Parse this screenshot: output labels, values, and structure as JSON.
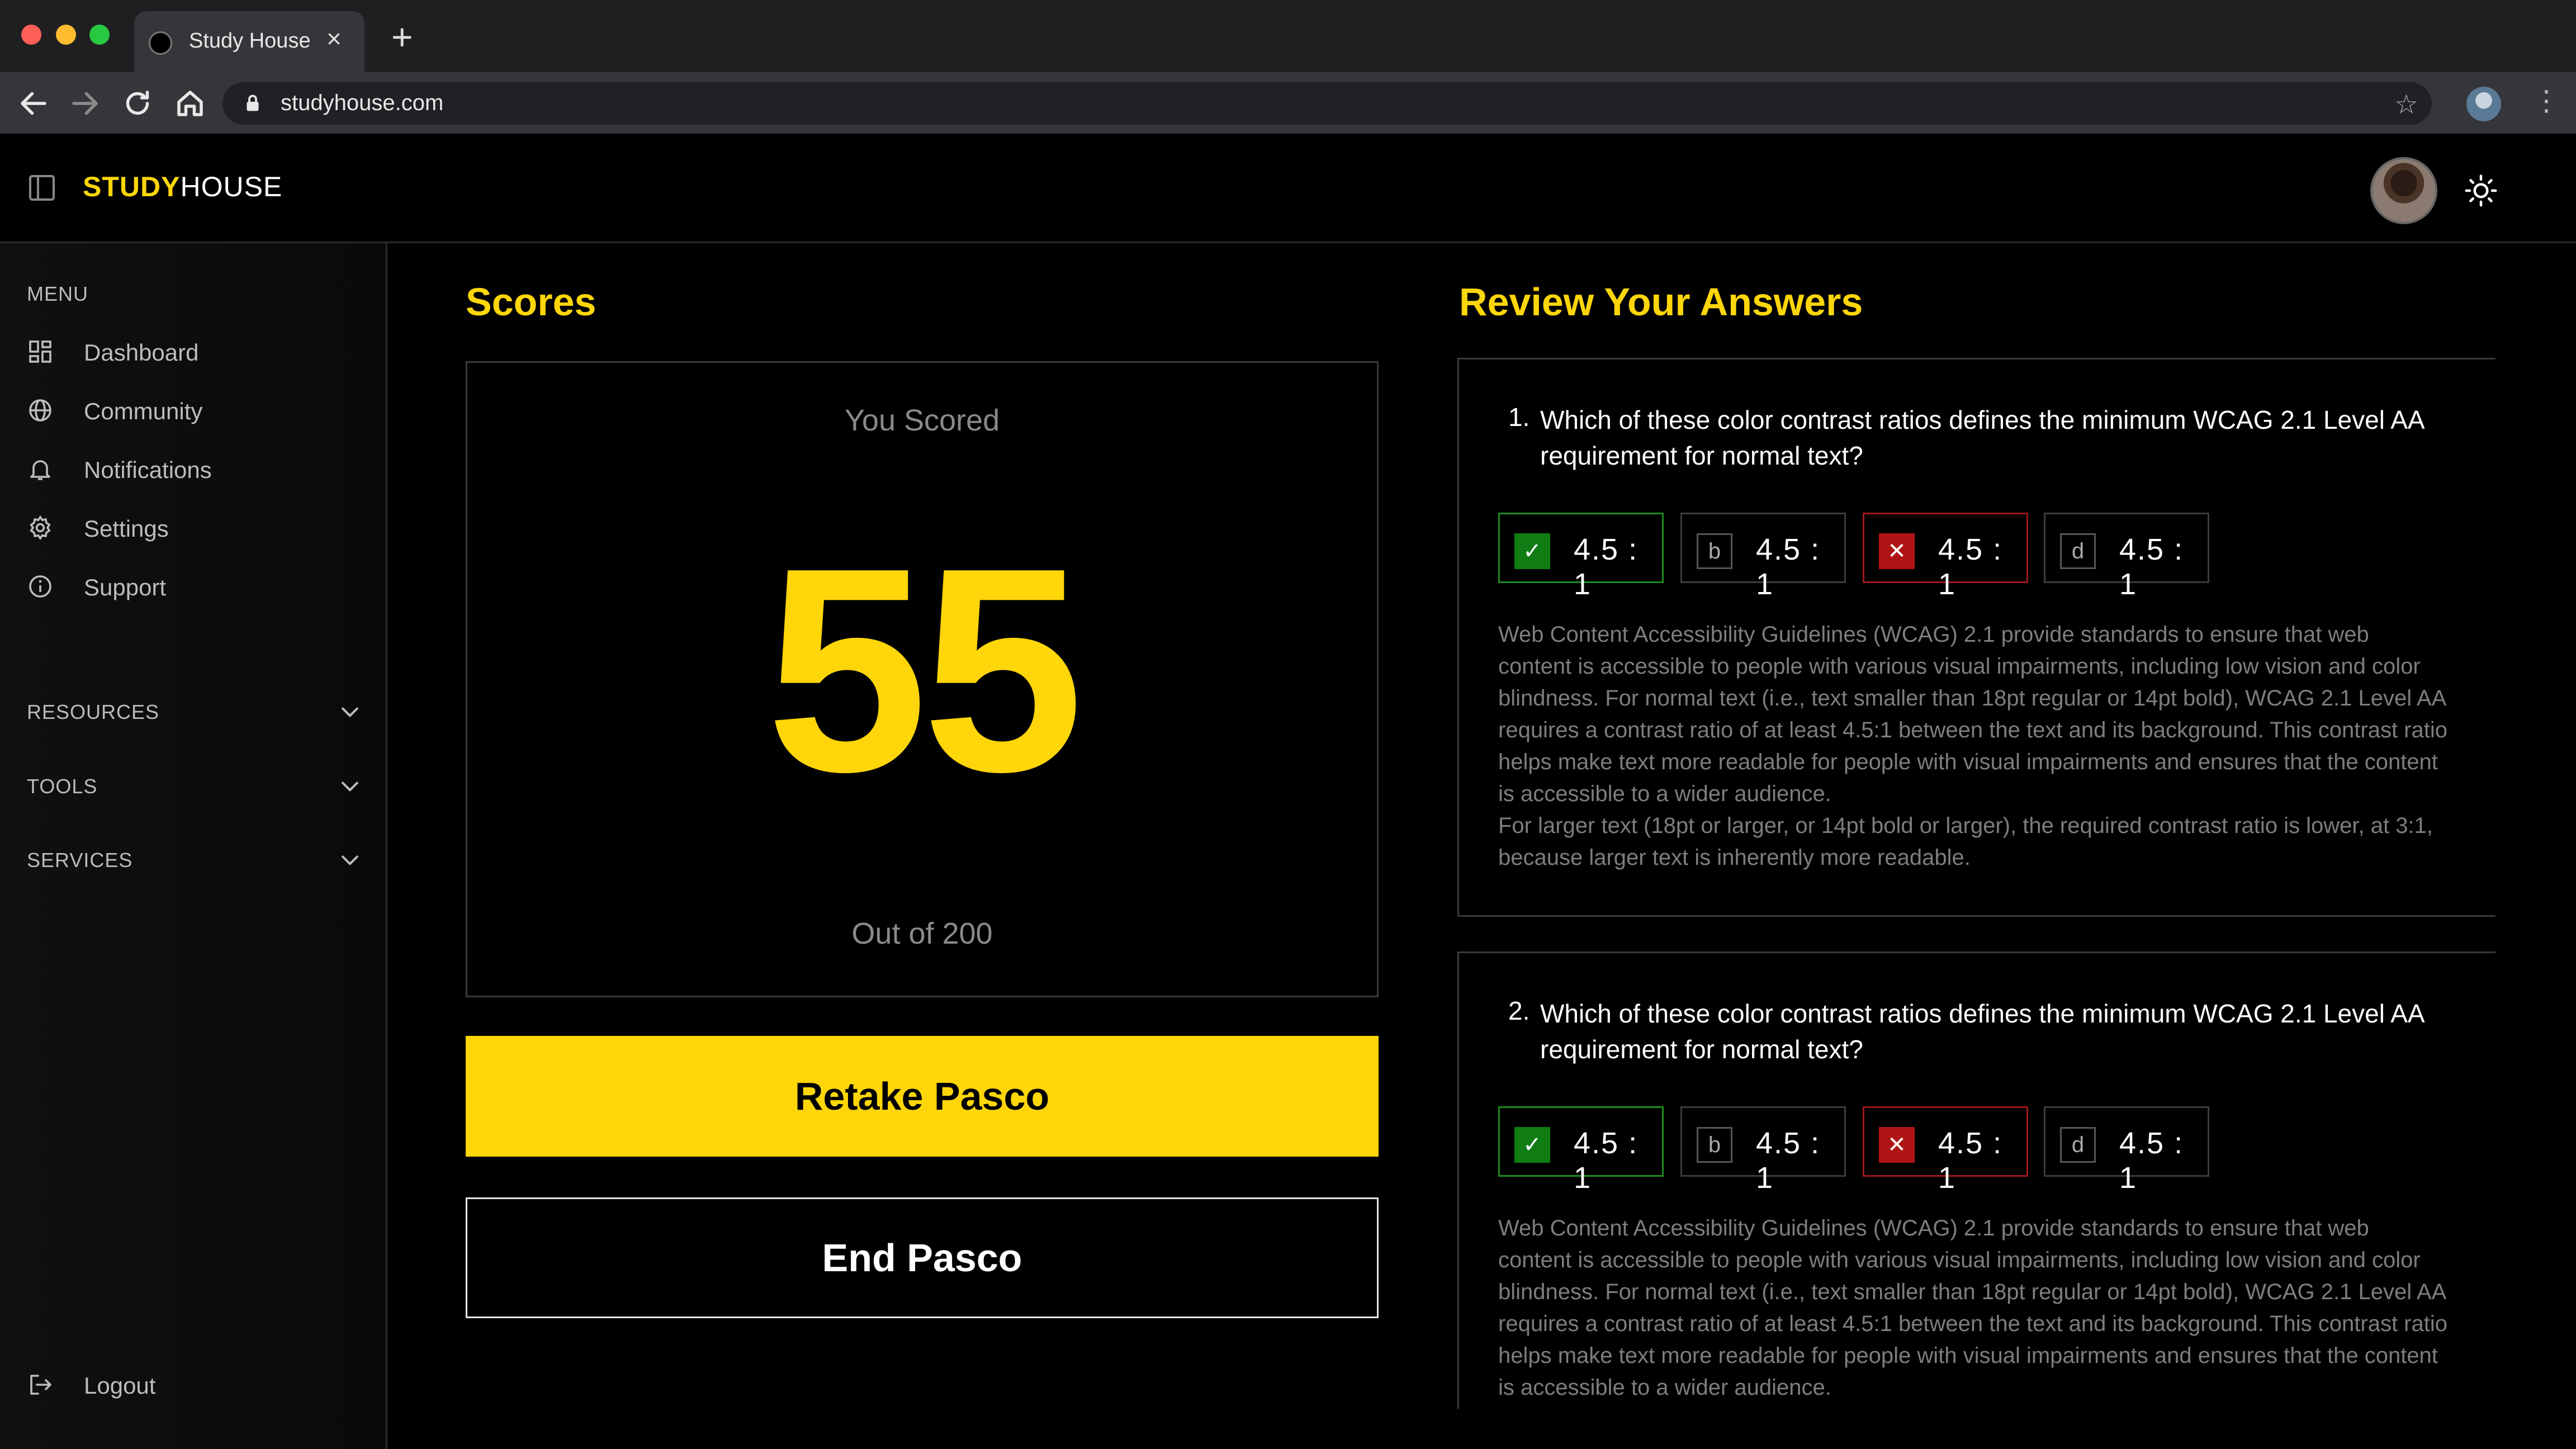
{
  "browser": {
    "tab_title": "Study House",
    "tab_close": "×",
    "new_tab": "+",
    "url": "studyhouse.com"
  },
  "header": {
    "logo_bold": "STUDY",
    "logo_regular": "HOUSE"
  },
  "sidebar": {
    "menu_title": "MENU",
    "items": [
      {
        "label": "Dashboard",
        "icon": "dashboard-icon"
      },
      {
        "label": "Community",
        "icon": "globe-icon"
      },
      {
        "label": "Notifications",
        "icon": "bell-icon"
      },
      {
        "label": "Settings",
        "icon": "gear-icon"
      },
      {
        "label": "Support",
        "icon": "info-icon"
      }
    ],
    "sections": [
      {
        "label": "RESOURCES"
      },
      {
        "label": "TOOLS"
      },
      {
        "label": "SERVICES"
      }
    ],
    "logout": "Logout"
  },
  "scores": {
    "title": "Scores",
    "you_scored": "You Scored",
    "score": "55",
    "out_of": "Out of 200",
    "retake_label": "Retake Pasco",
    "end_label": "End Pasco"
  },
  "review": {
    "title": "Review Your Answers",
    "questions": [
      {
        "number": "1.",
        "text": "Which of these color contrast ratios defines the minimum WCAG 2.1 Level AA requirement for normal text?",
        "options": [
          {
            "badge": "✓",
            "value": "4.5 : 1",
            "state": "correct"
          },
          {
            "badge": "b",
            "value": "4.5 : 1",
            "state": "neutral"
          },
          {
            "badge": "✕",
            "value": "4.5 : 1",
            "state": "wrong"
          },
          {
            "badge": "d",
            "value": "4.5 : 1",
            "state": "neutral"
          }
        ],
        "explanation_1": "Web Content Accessibility Guidelines (WCAG) 2.1 provide standards to ensure that web content is accessible to people with various visual impairments, including low vision and color blindness. For normal text (i.e., text smaller than 18pt regular or 14pt bold), WCAG 2.1 Level AA requires a contrast ratio of at least 4.5:1 between the text and its background. This contrast ratio helps make text more readable for people with visual impairments and ensures that the content is accessible to a wider audience.",
        "explanation_2": "For larger text (18pt or larger, or 14pt bold or larger), the required contrast ratio is lower, at 3:1, because larger text is inherently more readable."
      },
      {
        "number": "2.",
        "text": "Which of these color contrast ratios defines the minimum WCAG 2.1 Level AA requirement for normal text?",
        "options": [
          {
            "badge": "✓",
            "value": "4.5 : 1",
            "state": "correct"
          },
          {
            "badge": "b",
            "value": "4.5 : 1",
            "state": "neutral"
          },
          {
            "badge": "✕",
            "value": "4.5 : 1",
            "state": "wrong"
          },
          {
            "badge": "d",
            "value": "4.5 : 1",
            "state": "neutral"
          }
        ],
        "explanation_1": "Web Content Accessibility Guidelines (WCAG) 2.1 provide standards to ensure that web content is accessible to people with various visual impairments, including low vision and color blindness. For normal text (i.e., text smaller than 18pt regular or 14pt bold), WCAG 2.1 Level AA requires a contrast ratio of at least 4.5:1 between the text and its background. This contrast ratio helps make text more readable for people with visual impairments and ensures that the content is accessible to a wider audience."
      }
    ]
  },
  "colors": {
    "accent": "#ffd60a",
    "correct": "#0f7d14",
    "wrong": "#b01515",
    "background": "#000000"
  }
}
